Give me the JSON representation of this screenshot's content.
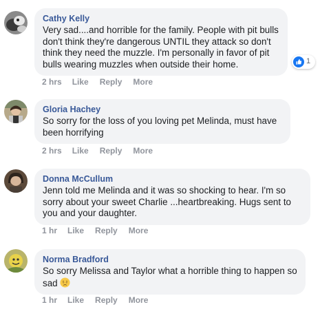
{
  "comments": [
    {
      "author": "Cathy Kelly",
      "text": "Very sad....and horrible for the family. People with pit bulls don't think they're dangerous UNTIL they attack so don't think they need the muzzle. I'm personally in favor of pit bulls wearing muzzles when outside their home.",
      "time": "2 hrs",
      "like_label": "Like",
      "reply_label": "Reply",
      "more_label": "More",
      "reactions": {
        "count": "1",
        "icon": "like-icon"
      }
    },
    {
      "author": "Gloria Hachey",
      "text": "So sorry for the loss of you loving pet Melinda, must have been horrifying",
      "time": "2 hrs",
      "like_label": "Like",
      "reply_label": "Reply",
      "more_label": "More"
    },
    {
      "author": "Donna McCullum",
      "text": "Jenn told me Melinda and it was so shocking to hear. I'm so sorry about your sweet Charlie ...heartbreaking. Hugs sent to you and your daughter.",
      "time": "1 hr",
      "like_label": "Like",
      "reply_label": "Reply",
      "more_label": "More"
    },
    {
      "author": "Norma Bradford",
      "text": "So sorry Melissa and Taylor what a horrible thing to happen so sad",
      "emoji": "disappointed-face-emoji",
      "time": "1 hr",
      "like_label": "Like",
      "reply_label": "Reply",
      "more_label": "More"
    }
  ],
  "colors": {
    "author": "#385898",
    "bubble": "#f2f3f5",
    "action": "#90949c",
    "like_blue": "#1877f2"
  }
}
